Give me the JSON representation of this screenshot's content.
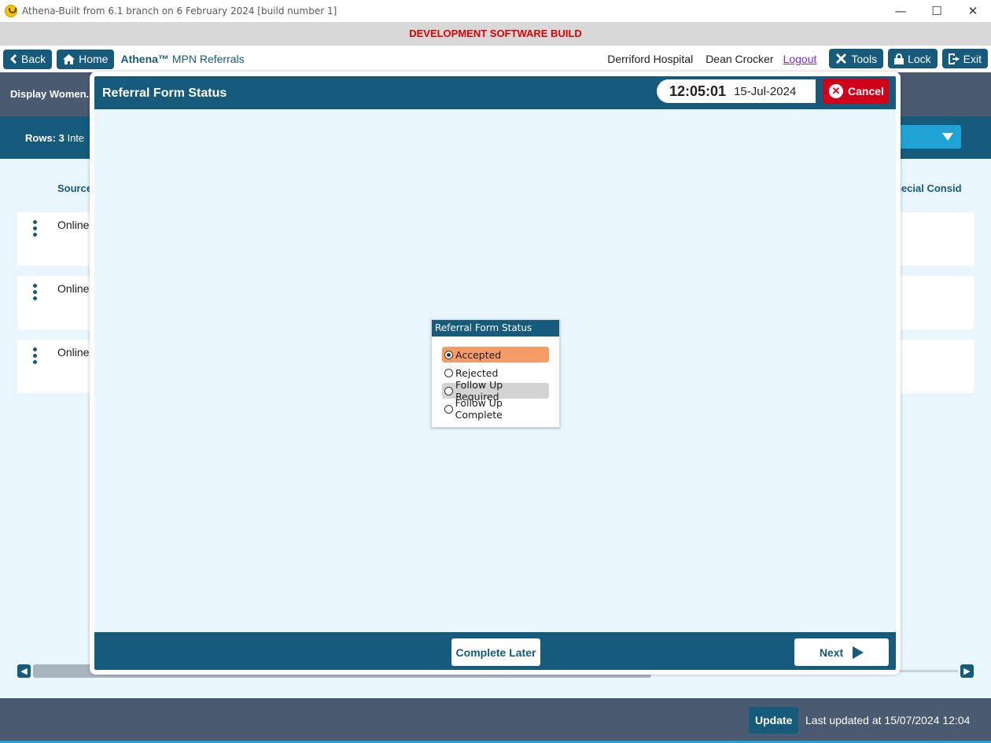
{
  "window": {
    "title": "Athena-Built from 6.1 branch on 6 February 2024 [build number 1]",
    "minimize": "—",
    "maximize": "☐",
    "close": "✕"
  },
  "banner": "DEVELOPMENT SOFTWARE BUILD",
  "nav": {
    "back": "Back",
    "home": "Home",
    "brand_name": "Athena™",
    "brand_module": "MPN Referrals",
    "hospital": "Derriford Hospital",
    "user": "Dean Crocker",
    "logout": "Logout",
    "tools": "Tools",
    "lock": "Lock",
    "exit": "Exit"
  },
  "page": {
    "heading": "Display Women...",
    "rows_label": "Rows: 3",
    "rows_extra": "Inte",
    "col_source": "Source",
    "col_special": "pecial Consid",
    "rows": [
      {
        "source": "Online"
      },
      {
        "source": "Online"
      },
      {
        "source": "Online"
      }
    ]
  },
  "modal": {
    "title": "Referral Form Status",
    "time": "12:05:01",
    "date": "15-Jul-2024",
    "cancel": "Cancel",
    "complete_later": "Complete Later",
    "next": "Next"
  },
  "status_panel": {
    "title": "Referral Form Status",
    "options": [
      {
        "label": "Accepted",
        "selected": true
      },
      {
        "label": "Rejected",
        "selected": false
      },
      {
        "label": "Follow Up Required",
        "selected": false
      },
      {
        "label": "Follow Up Complete",
        "selected": false
      }
    ]
  },
  "footer": {
    "update": "Update",
    "last_updated": "Last updated at 15/07/2024 12:04"
  },
  "colors": {
    "primary": "#165a7c",
    "dev_banner_text": "#e00000",
    "cancel": "#d0021b",
    "selected_option": "#f59b67"
  }
}
